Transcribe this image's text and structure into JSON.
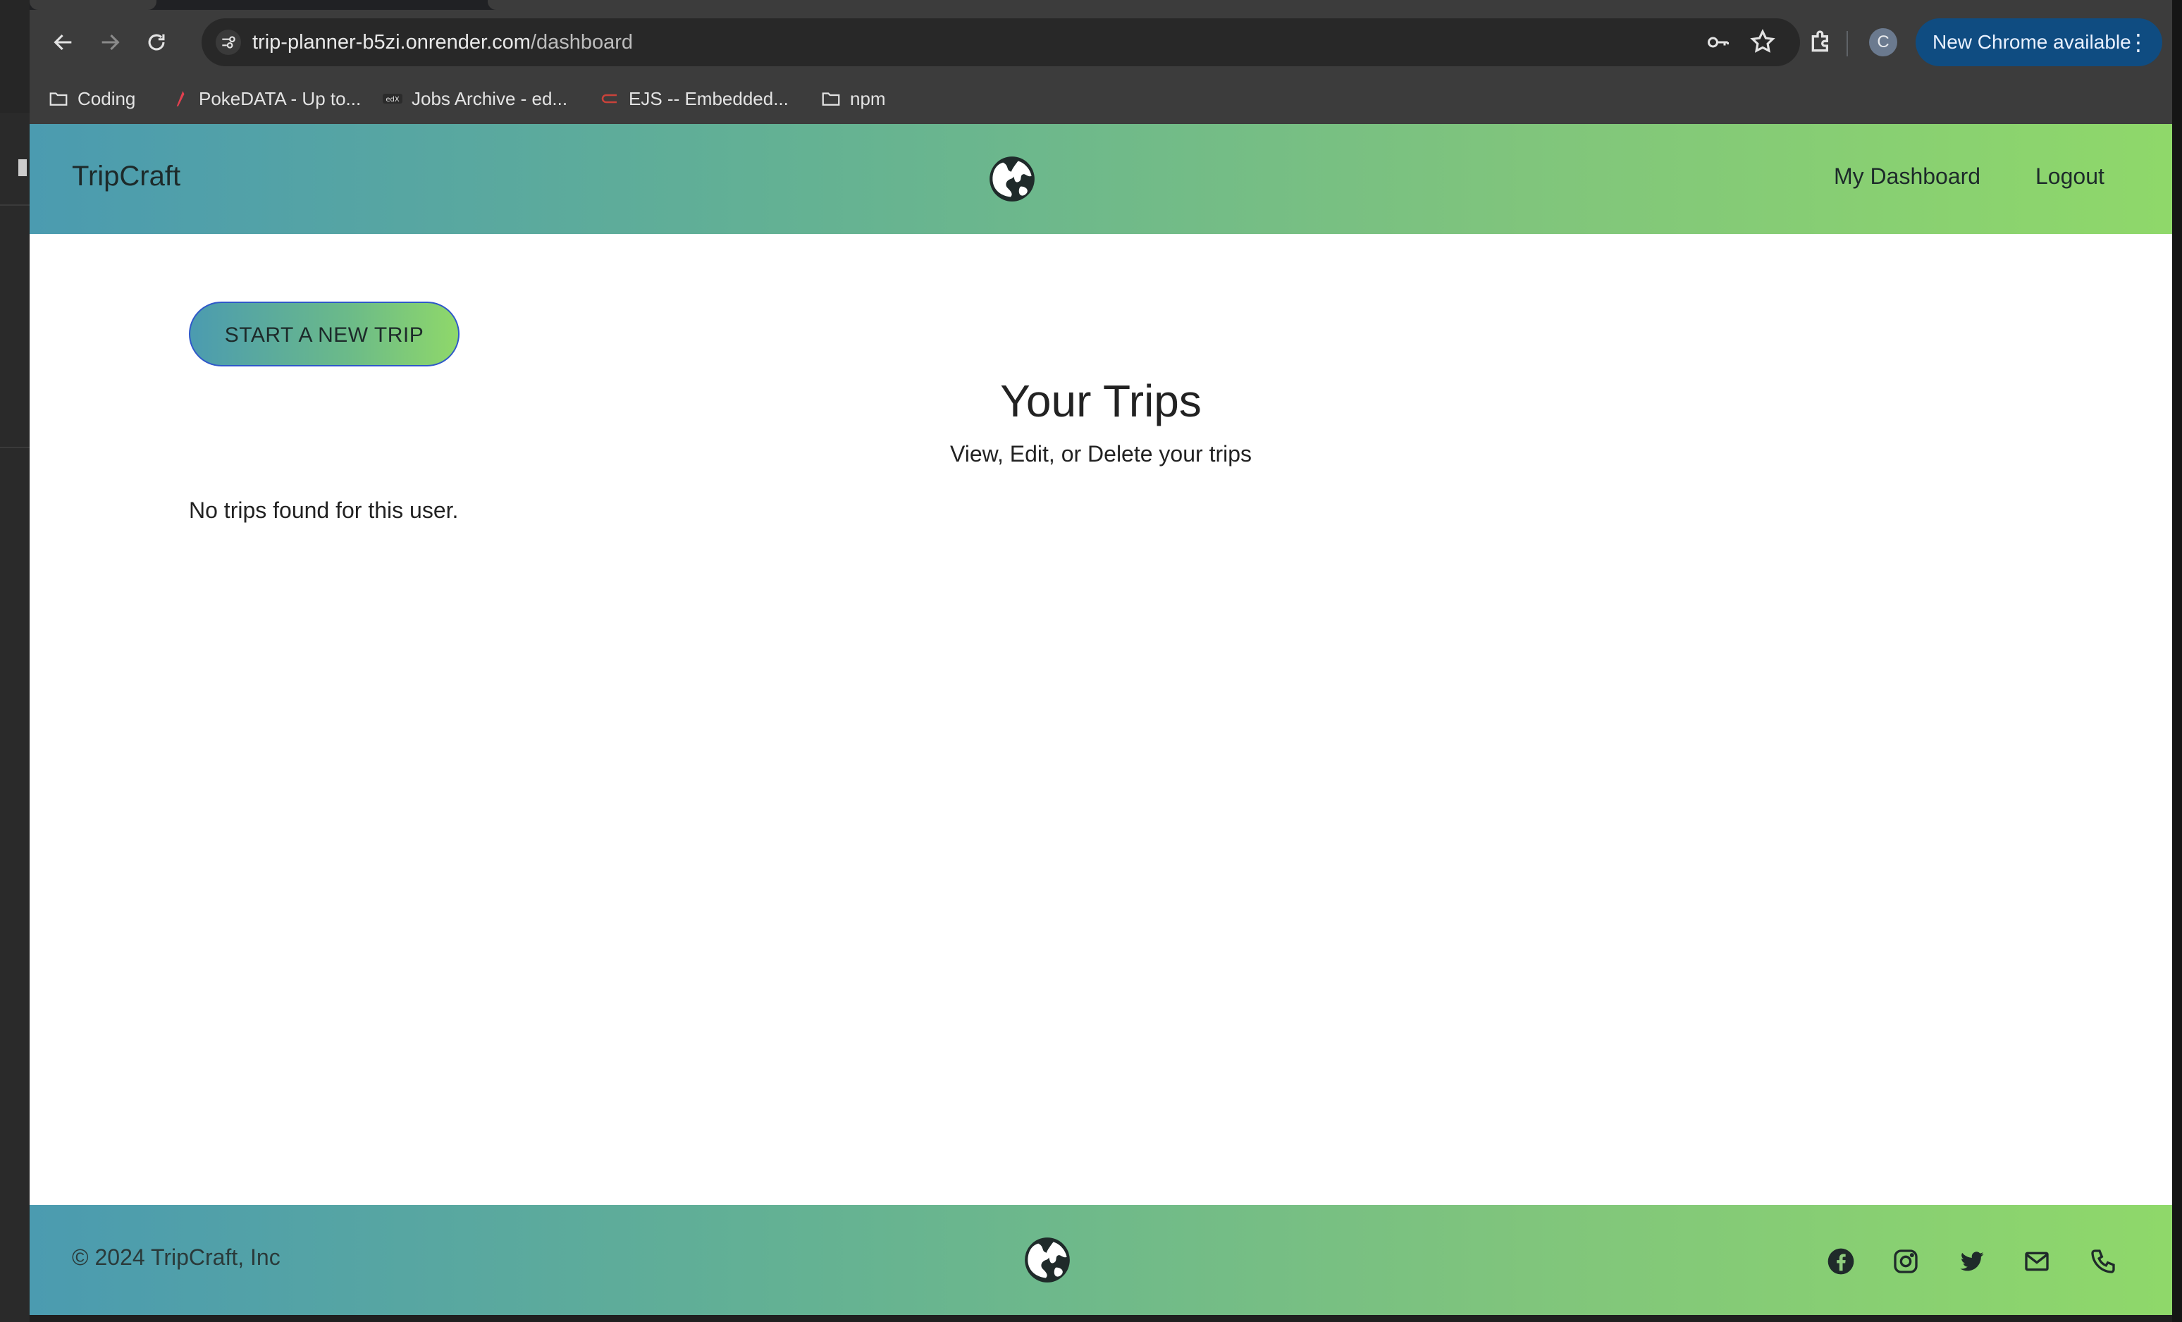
{
  "browser": {
    "url_host": "trip-planner-b5zi.onrender.com",
    "url_path": "/dashboard",
    "avatar_letter": "C",
    "update_label": "New Chrome available",
    "update_menu": "⋮",
    "bookmarks": [
      {
        "label": "Coding",
        "icon": "folder-icon"
      },
      {
        "label": "PokeDATA - Up to...",
        "icon": "pokedata-favicon"
      },
      {
        "label": "Jobs Archive - ed...",
        "icon": "edx-favicon"
      },
      {
        "label": "EJS -- Embedded...",
        "icon": "ejs-favicon"
      },
      {
        "label": "npm",
        "icon": "folder-icon"
      }
    ]
  },
  "header": {
    "brand": "TripCraft",
    "logo_icon": "globe-icon",
    "nav": [
      "My Dashboard",
      "Logout"
    ]
  },
  "main": {
    "cta_label": "START A NEW TRIP",
    "title": "Your Trips",
    "subtitle": "View, Edit, or Delete your trips",
    "empty_message": "No trips found for this user."
  },
  "footer": {
    "copyright": "© 2024 TripCraft, Inc",
    "logo_icon": "globe-icon",
    "social_icons": [
      "facebook-icon",
      "instagram-icon",
      "twitter-icon",
      "mail-icon",
      "phone-icon"
    ]
  },
  "colors": {
    "gradient_start": "#4b9bb0",
    "gradient_end": "#8fd86a",
    "cta_border": "#2f58c9",
    "chrome_update": "#0f4c81"
  }
}
